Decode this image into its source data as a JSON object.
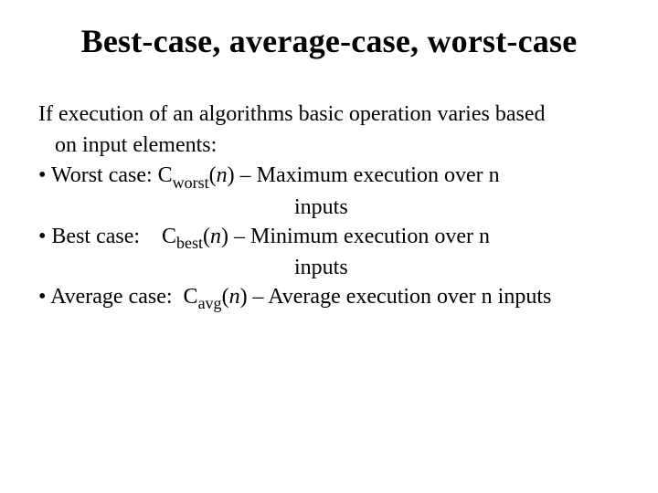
{
  "title": "Best-case, average-case, worst-case",
  "intro_l1": "If execution of an algorithms basic operation varies based",
  "intro_l2": "on input elements:",
  "bullets": {
    "worst": {
      "label_prefix": "• Worst case: C",
      "sub": "worst",
      "post_n": ") –  Maximum execution over n",
      "cont": "inputs"
    },
    "best": {
      "label_prefix": "• Best case:    C",
      "sub": "best",
      "post_n": ") –  Minimum execution over n",
      "cont": "inputs"
    },
    "avg": {
      "label_prefix": "• Average case:  C",
      "sub": "avg",
      "post_n": ") – Average execution over n inputs"
    }
  },
  "n_italic": "n",
  "lp": "("
}
